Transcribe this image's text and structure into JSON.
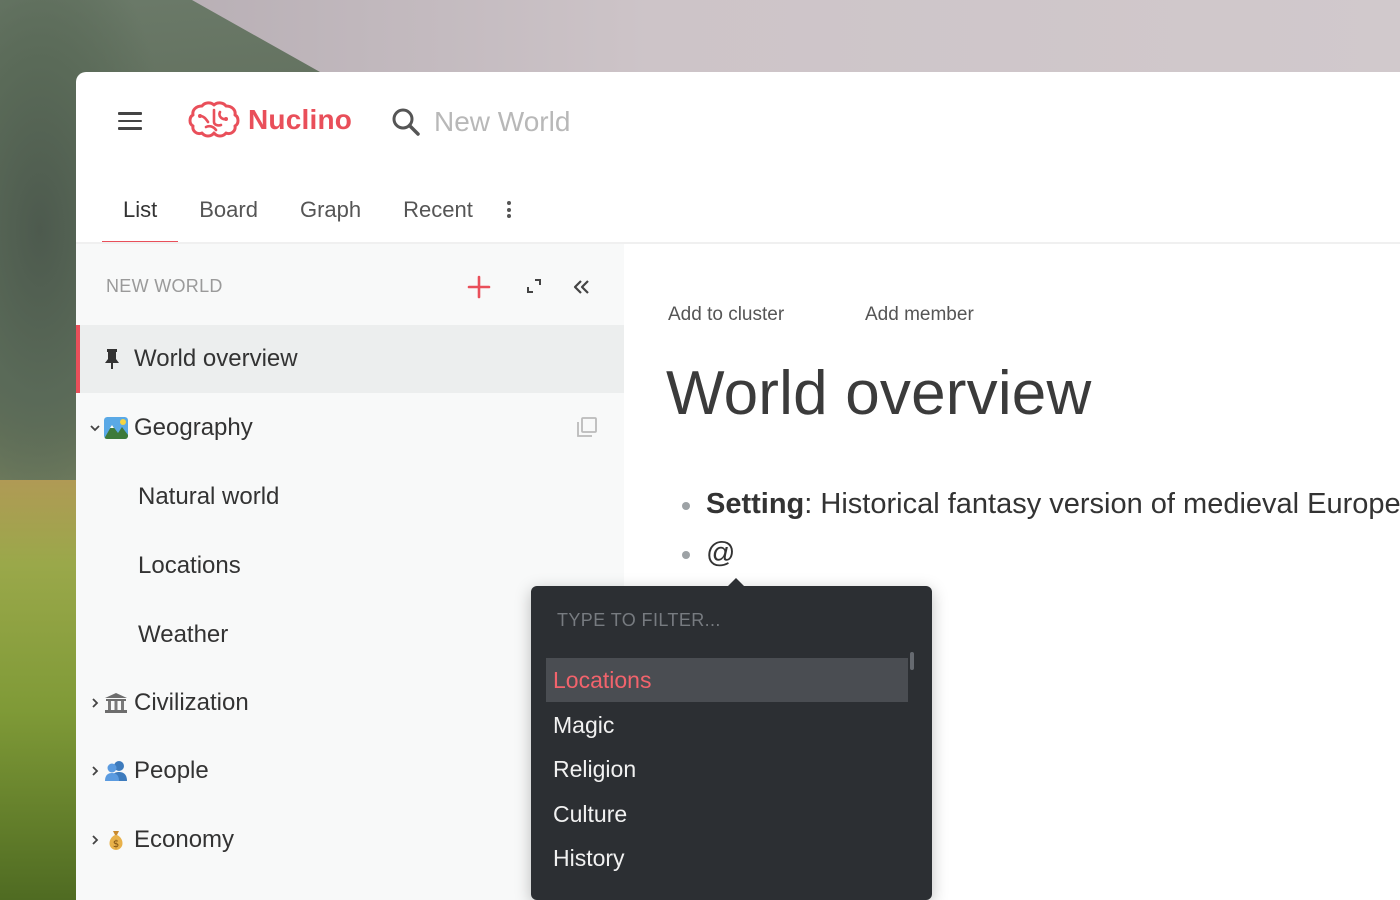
{
  "app": {
    "name": "Nuclino",
    "brand_color": "#e94f5a"
  },
  "search": {
    "placeholder": "New World"
  },
  "tabs": [
    {
      "label": "List",
      "active": true
    },
    {
      "label": "Board",
      "active": false
    },
    {
      "label": "Graph",
      "active": false
    },
    {
      "label": "Recent",
      "active": false
    }
  ],
  "sidebar": {
    "workspace_title": "NEW WORLD",
    "items": [
      {
        "label": "World overview",
        "icon": "pin-icon",
        "active": true
      },
      {
        "label": "Geography",
        "icon": "landscape-emoji-icon",
        "expanded": true
      },
      {
        "label": "Natural world"
      },
      {
        "label": "Locations"
      },
      {
        "label": "Weather"
      },
      {
        "label": "Civilization",
        "icon": "classical-building-emoji-icon",
        "expanded": false
      },
      {
        "label": "People",
        "icon": "people-emoji-icon",
        "expanded": false
      },
      {
        "label": "Economy",
        "icon": "money-bag-emoji-icon",
        "expanded": false
      }
    ]
  },
  "document": {
    "add_to_cluster": "Add to cluster",
    "add_member": "Add member",
    "title": "World overview",
    "bullets": [
      {
        "bold": "Setting",
        "text": ": Historical fantasy version of medieval Europe"
      },
      {
        "bold": "",
        "text": "@"
      }
    ]
  },
  "mention_menu": {
    "placeholder": "TYPE TO FILTER...",
    "options": [
      "Locations",
      "Magic",
      "Religion",
      "Culture",
      "History"
    ],
    "selected": "Locations"
  }
}
